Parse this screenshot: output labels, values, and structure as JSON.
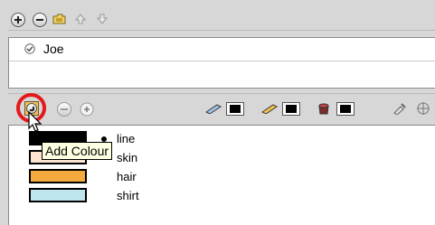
{
  "palette_list": {
    "toolbar": [
      "add-palette-icon",
      "remove-palette-icon",
      "import-palette-icon",
      "move-up-icon",
      "move-down-icon"
    ],
    "items": [
      {
        "name": "Joe",
        "locked_icon": "check-circle-icon"
      }
    ]
  },
  "colour_toolbar": {
    "add_colour_tooltip": "Add Colour",
    "buttons": [
      "add-colour-button",
      "remove-colour-button",
      "link-colour-button",
      "brush-swatch",
      "pencil-swatch",
      "paint-swatch",
      "eyedropper-icon",
      "crosshair-icon"
    ]
  },
  "colours": [
    {
      "name": "line",
      "hex": "#000000",
      "selected": true
    },
    {
      "name": "skin",
      "hex": "#fde4d0",
      "partially_hidden": true
    },
    {
      "name": "hair",
      "hex": "#f5aa3e"
    },
    {
      "name": "shirt",
      "hex": "#bfe6ee"
    }
  ],
  "accent": {
    "highlight_circle": "#e3191a",
    "button_active": "#f0c060"
  }
}
